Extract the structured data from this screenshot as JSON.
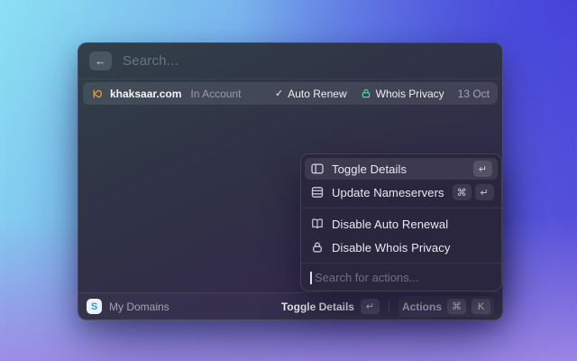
{
  "window": {
    "search": {
      "back_glyph": "←",
      "placeholder": "Search..."
    },
    "domain_row": {
      "domain": "khaksaar.com",
      "account_status": "In Account",
      "check_glyph": "✓",
      "auto_renew_label": "Auto Renew",
      "whois_label": "Whois Privacy",
      "renewal_date": "13 Oct"
    },
    "status_bar": {
      "app_logo_letter": "S",
      "app_label": "My Domains",
      "primary_label": "Toggle Details",
      "primary_key": "↵",
      "actions_label": "Actions",
      "actions_key_1": "⌘",
      "actions_key_2": "K"
    }
  },
  "actions_menu": {
    "items": [
      {
        "label": "Toggle Details",
        "key_1": "↵"
      },
      {
        "label": "Update Nameservers",
        "key_1": "⌘",
        "key_2": "↵"
      },
      {
        "label": "Disable Auto Renewal"
      },
      {
        "label": "Disable Whois Privacy"
      }
    ],
    "search_placeholder": "Search for actions..."
  },
  "colors": {
    "whois_lock_green": "#3edf9c",
    "favicon_orange": "#e2a23b"
  }
}
